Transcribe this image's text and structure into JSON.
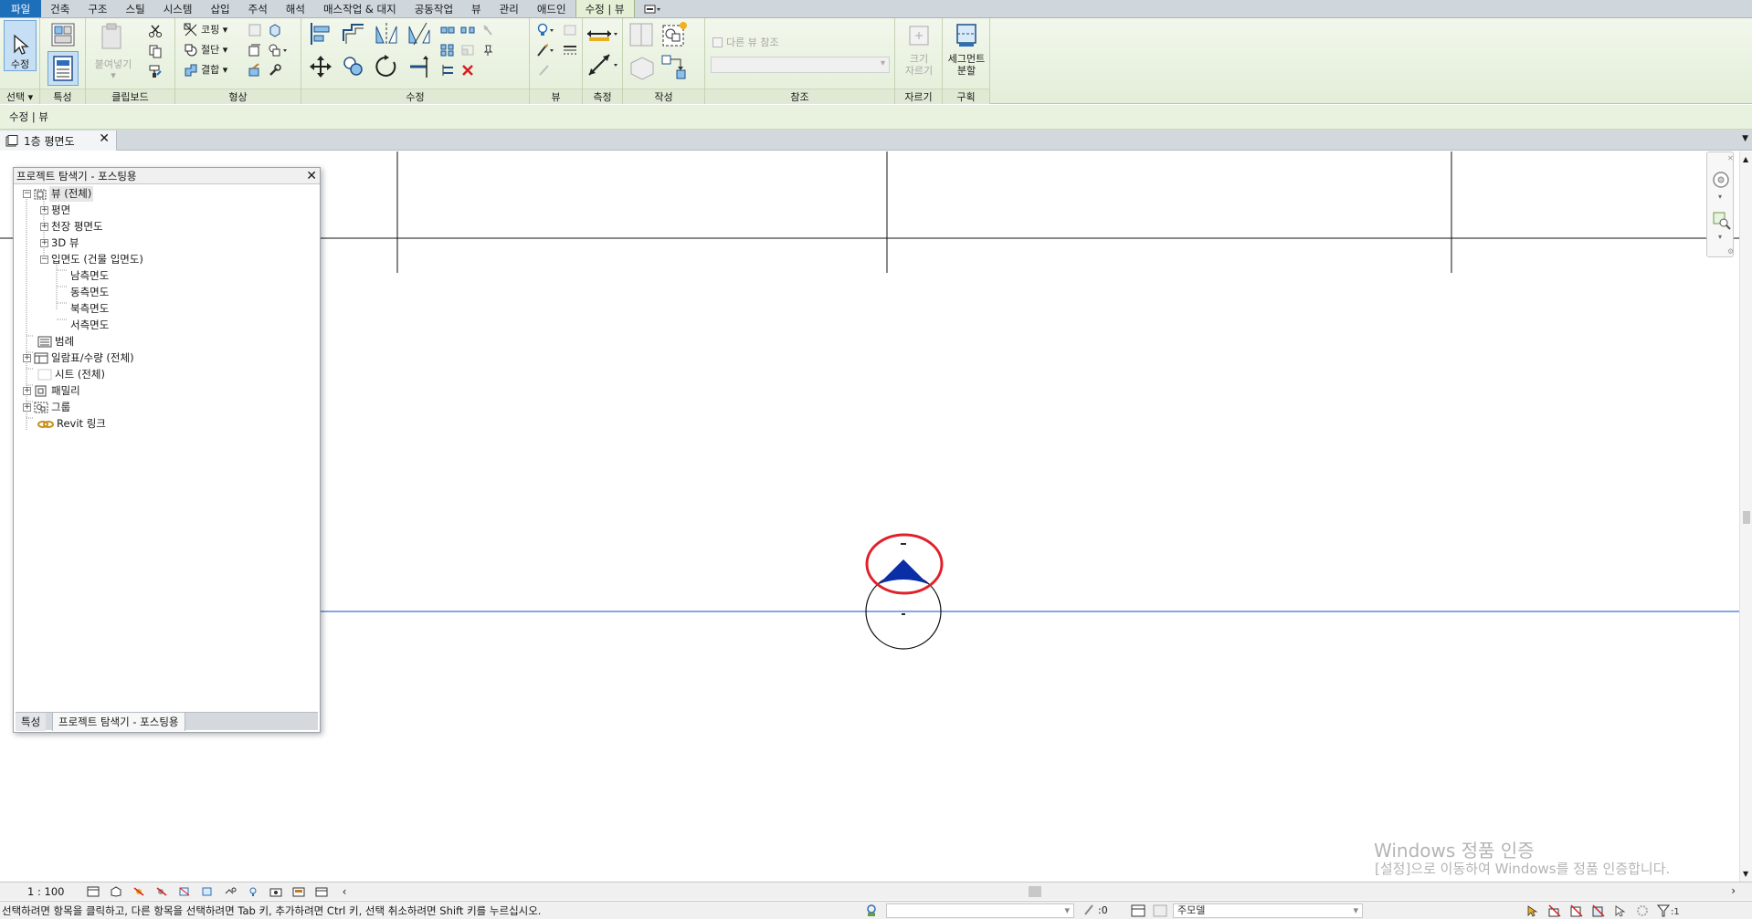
{
  "ribbon": {
    "tabs": [
      "파일",
      "건축",
      "구조",
      "스틸",
      "시스템",
      "삽입",
      "주석",
      "해석",
      "매스작업 & 대지",
      "공동작업",
      "뷰",
      "관리",
      "애드인",
      "수정 | 뷰"
    ],
    "panels": {
      "select": {
        "label": "선택",
        "modify_button": "수정"
      },
      "properties": {
        "label": "특성"
      },
      "clipboard": {
        "label": "클립보드",
        "paste_button": "붙여넣기"
      },
      "geometry": {
        "label": "형상",
        "cope_button": "코핑",
        "cut_button": "절단",
        "join_button": "결합"
      },
      "modify": {
        "label": "수정"
      },
      "view": {
        "label": "뷰"
      },
      "measure": {
        "label": "측정"
      },
      "create": {
        "label": "작성"
      },
      "reference": {
        "label": "참조",
        "other_view_checkbox": "다른 뷰 참조"
      },
      "crop": {
        "label": "자르기",
        "size_crop_button": "크기\n자르기"
      },
      "region": {
        "label": "구획",
        "split_segment_button": "세그먼트\n분할"
      }
    },
    "colors": {
      "file_tab": "#1e6fb9",
      "ribbon_bg": "#e3eed8"
    }
  },
  "context_bar": {
    "label": "수정 | 뷰"
  },
  "view_tabs": [
    {
      "label": "1층 평면도"
    }
  ],
  "project_browser": {
    "title": "프로젝트 탐색기 - 포스팅용",
    "tree": [
      {
        "label": "뷰 (전체)"
      },
      {
        "label": "평면"
      },
      {
        "label": "천장 평면도"
      },
      {
        "label": "3D 뷰"
      },
      {
        "label": "입면도 (건물 입면도)"
      },
      {
        "label": "남측면도"
      },
      {
        "label": "동측면도"
      },
      {
        "label": "북측면도"
      },
      {
        "label": "서측면도"
      },
      {
        "label": "범례"
      },
      {
        "label": "일람표/수량 (전체)"
      },
      {
        "label": "시트 (전체)"
      },
      {
        "label": "패밀리"
      },
      {
        "label": "그룹"
      },
      {
        "label": "Revit 링크"
      }
    ],
    "footer_tabs": [
      "특성",
      "프로젝트 탐색기 - 포스팅용"
    ]
  },
  "canvas": {
    "colors": {
      "elevation_marker": "#0a2ea8",
      "highlight_circle": "#e0202a",
      "level_line": "#3e6fd8"
    }
  },
  "watermark": {
    "line1": "Windows 정품 인증",
    "line2": "[설정]으로 이동하여 Windows를 정품 인증합니다."
  },
  "view_control_bar": {
    "scale": "1 : 100"
  },
  "status_bar": {
    "message": "선택하려면 항목을 클릭하고, 다른 항목을 선택하려면 Tab 키, 추가하려면 Ctrl 키, 선택 취소하려면 Shift 키를 누르십시오.",
    "worksets_value": ":0",
    "model_value": "주모델"
  }
}
